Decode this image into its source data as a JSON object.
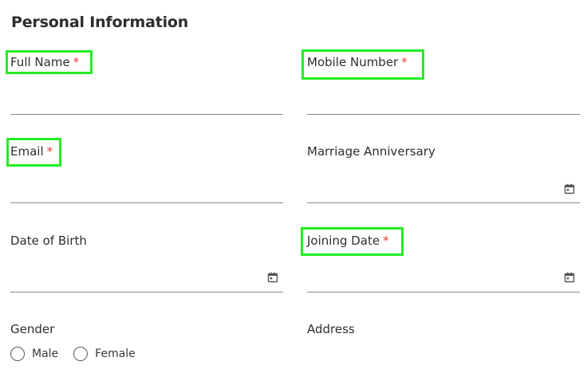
{
  "section_title": "Personal Information",
  "required_marker": "*",
  "fields": {
    "full_name": {
      "label": "Full Name",
      "value": ""
    },
    "mobile_number": {
      "label": "Mobile Number",
      "value": ""
    },
    "email": {
      "label": "Email",
      "value": ""
    },
    "marriage_anniversary": {
      "label": "Marriage Anniversary",
      "value": "",
      "icon": "calendar-icon"
    },
    "date_of_birth": {
      "label": "Date of Birth",
      "value": "",
      "icon": "calendar-icon"
    },
    "joining_date": {
      "label": "Joining Date",
      "value": "",
      "icon": "calendar-icon"
    },
    "gender": {
      "label": "Gender",
      "options": [
        "Male",
        "Female"
      ]
    },
    "address": {
      "label": "Address"
    }
  },
  "highlight_color": "#22ee22"
}
